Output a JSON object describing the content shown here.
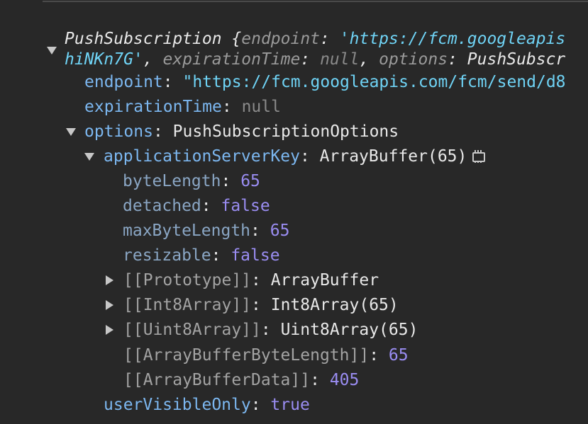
{
  "summary": {
    "line1_prefix": "PushSubscription {",
    "line1_key": "endpoint",
    "line1_sep": ": ",
    "line1_val": "'https://fcm.googleapis",
    "line2_val_tail": "hiNKn7G'",
    "line2_sep1": ", ",
    "line2_key1": "expirationTime",
    "line2_sep2": ": ",
    "line2_null": "null",
    "line2_sep3": ", ",
    "line2_key2": "options",
    "line2_sep4": ": ",
    "line2_val2": "PushSubscr"
  },
  "props": {
    "endpoint": {
      "key": "endpoint",
      "value": "\"https://fcm.googleapis.com/fcm/send/d8"
    },
    "expirationTime": {
      "key": "expirationTime",
      "value": "null"
    },
    "options": {
      "key": "options",
      "value": "PushSubscriptionOptions"
    },
    "applicationServerKey": {
      "key": "applicationServerKey",
      "value": "ArrayBuffer(65)"
    },
    "byteLength": {
      "key": "byteLength",
      "value": "65"
    },
    "detached": {
      "key": "detached",
      "value": "false"
    },
    "maxByteLength": {
      "key": "maxByteLength",
      "value": "65"
    },
    "resizable": {
      "key": "resizable",
      "value": "false"
    },
    "prototype": {
      "key": "[[Prototype]]",
      "value": "ArrayBuffer"
    },
    "int8": {
      "key": "[[Int8Array]]",
      "value": "Int8Array(65)"
    },
    "uint8": {
      "key": "[[Uint8Array]]",
      "value": "Uint8Array(65)"
    },
    "abByteLength": {
      "key": "[[ArrayBufferByteLength]]",
      "value": "65"
    },
    "abData": {
      "key": "[[ArrayBufferData]]",
      "value": "405"
    },
    "userVisibleOnly": {
      "key": "userVisibleOnly",
      "value": "true"
    }
  },
  "colon": ": ",
  "icons": {
    "expand": "triangle-down-icon",
    "collapse": "triangle-right-icon",
    "memory": "memory-inspector-icon"
  },
  "colors": {
    "background": "#282828",
    "key": "#7cb7f0",
    "string": "#6fd3f5",
    "number": "#9a8df2",
    "null": "#8a8a8a"
  }
}
